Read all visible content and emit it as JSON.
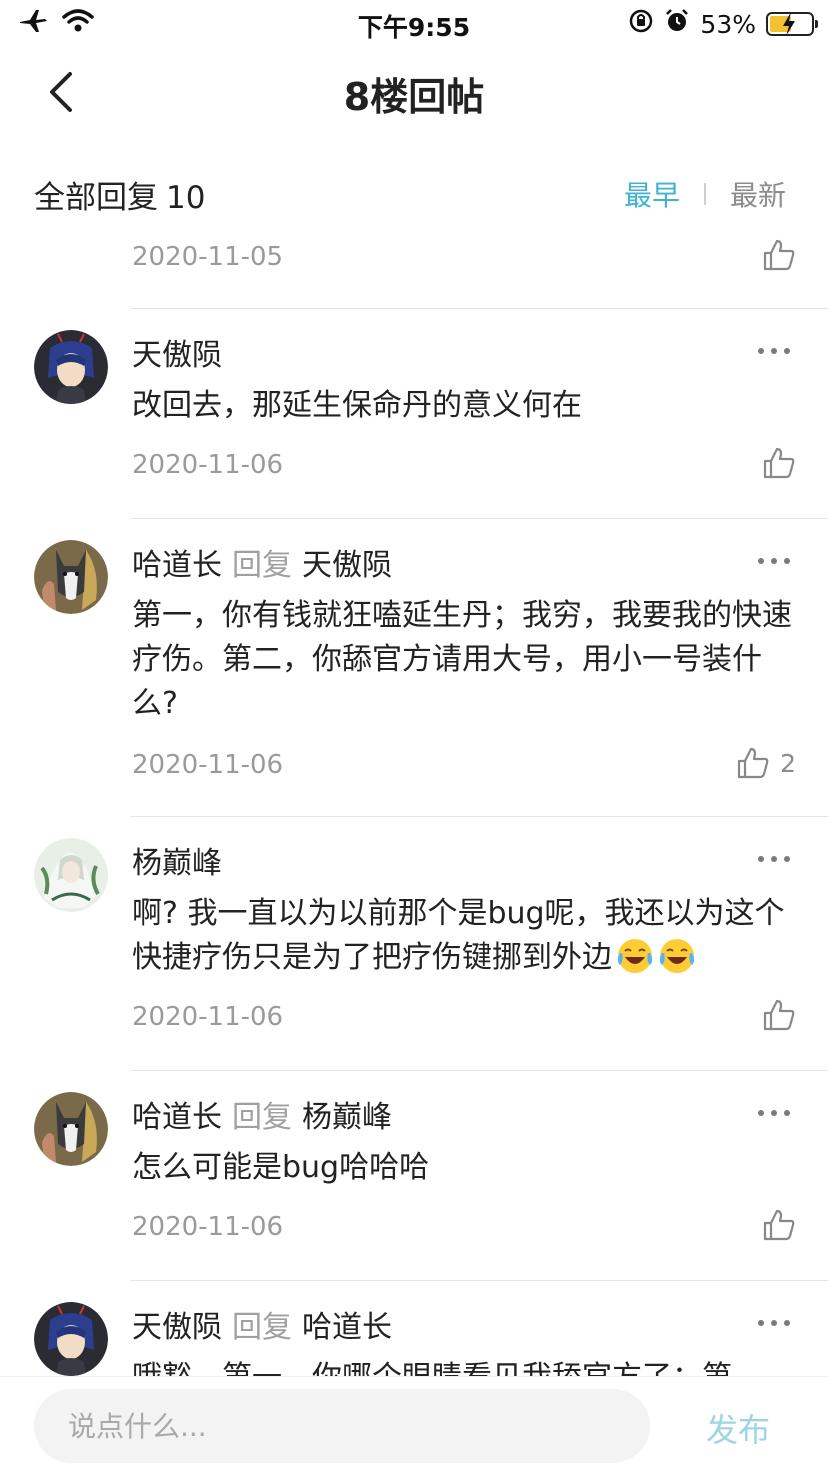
{
  "status_bar": {
    "time": "下午9:55",
    "battery": "53%",
    "battery_level": 0.53
  },
  "nav": {
    "title": "8楼回帖"
  },
  "reply_header": {
    "label": "全部回复",
    "count": "10",
    "sort_earliest": "最早",
    "sort_latest": "最新",
    "active_sort": "最早"
  },
  "first_partial": {
    "date": "2020-11-05"
  },
  "reply_word": "回复",
  "comments": [
    {
      "author": "天傲陨",
      "reply_to": "",
      "content": "改回去，那延生保命丹的意义何在",
      "date": "2020-11-06",
      "likes": ""
    },
    {
      "author": "哈道长",
      "reply_to": "天傲陨",
      "content": "第一，你有钱就狂嗑延生丹；我穷，我要我的快速疗伤。第二，你舔官方请用大号，用小一号装什么?",
      "date": "2020-11-06",
      "likes": "2"
    },
    {
      "author": "杨巅峰",
      "reply_to": "",
      "content": "啊? 我一直以为以前那个是bug呢，我还以为这个快捷疗伤只是为了把疗伤键挪到外边",
      "date": "2020-11-06",
      "likes": ""
    },
    {
      "author": "哈道长",
      "reply_to": "杨巅峰",
      "content": "怎么可能是bug哈哈哈",
      "date": "2020-11-06",
      "likes": ""
    },
    {
      "author": "天傲陨",
      "reply_to": "哈道长",
      "content": "哦豁，第一，你哪个眼睛看见我舔官方了；第",
      "date": "",
      "likes": ""
    }
  ],
  "bottom_bar": {
    "placeholder": "说点什么...",
    "publish": "发布"
  },
  "colors": {
    "accent": "#3fb3cf",
    "publish_disabled": "#9fd5e2",
    "muted": "#9a9a9a"
  }
}
